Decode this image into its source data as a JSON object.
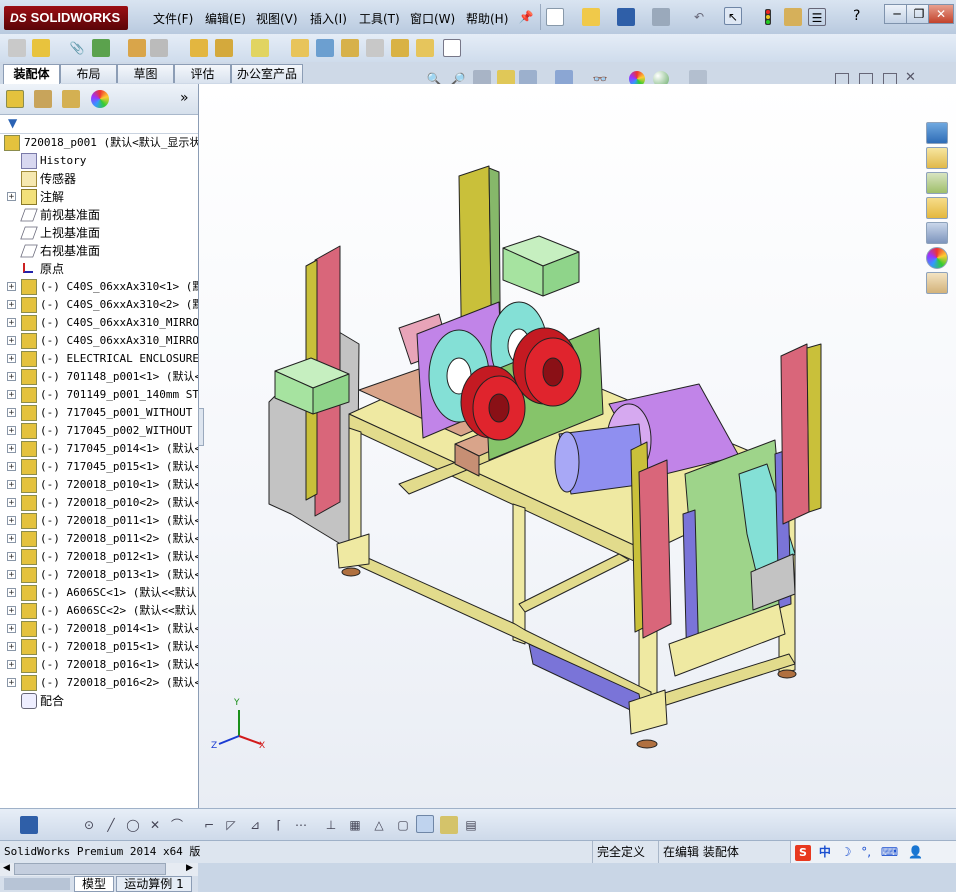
{
  "app": {
    "logo_text": "SOLIDWORKS",
    "logo_prefix": "DS",
    "brand_color": "#8b0c12"
  },
  "menu": [
    {
      "label": "文件(F)"
    },
    {
      "label": "编辑(E)"
    },
    {
      "label": "视图(V)"
    },
    {
      "label": "插入(I)"
    },
    {
      "label": "工具(T)"
    },
    {
      "label": "窗口(W)"
    },
    {
      "label": "帮助(H)"
    }
  ],
  "window_buttons": {
    "minimize": "─",
    "restore": "❐",
    "close": "✕",
    "help": "?"
  },
  "tabs": [
    {
      "label": "装配体",
      "active": true
    },
    {
      "label": "布局",
      "active": false
    },
    {
      "label": "草图",
      "active": false
    },
    {
      "label": "评估",
      "active": false
    },
    {
      "label": "办公室产品",
      "active": false
    }
  ],
  "tree": {
    "root": "720018_p001  (默认<默认_显示状",
    "items": [
      {
        "label": "History",
        "icon": "history-icon",
        "expand": false
      },
      {
        "label": "传感器",
        "icon": "sensor-icon",
        "expand": false
      },
      {
        "label": "注解",
        "icon": "annotation-icon",
        "expand": true
      },
      {
        "label": "前视基准面",
        "icon": "plane-icon",
        "expand": false
      },
      {
        "label": "上视基准面",
        "icon": "plane-icon",
        "expand": false
      },
      {
        "label": "右视基准面",
        "icon": "plane-icon",
        "expand": false
      },
      {
        "label": "原点",
        "icon": "origin-icon",
        "expand": false
      },
      {
        "label": "(-) C40S_06xxAx310<1> (默认",
        "icon": "part-icon",
        "expand": true
      },
      {
        "label": "(-) C40S_06xxAx310<2> (默认",
        "icon": "part-icon",
        "expand": true
      },
      {
        "label": "(-) C40S_06xxAx310_MIRROR<",
        "icon": "part-icon",
        "expand": true
      },
      {
        "label": "(-) C40S_06xxAx310_MIRROR<",
        "icon": "part-icon",
        "expand": true
      },
      {
        "label": "(-) ELECTRICAL ENCLOSURE<",
        "icon": "part-icon",
        "expand": true
      },
      {
        "label": "(-) 701148_p001<1> (默认<",
        "icon": "part-icon",
        "expand": true
      },
      {
        "label": "(-) 701149_p001_140mm STAG",
        "icon": "part-icon",
        "expand": true
      },
      {
        "label": "(-) 717045_p001_WITHOUT OI",
        "icon": "part-icon",
        "expand": true
      },
      {
        "label": "(-) 717045_p002_WITHOUT OI",
        "icon": "part-icon",
        "expand": true
      },
      {
        "label": "(-) 717045_p014<1> (默认<",
        "icon": "part-icon",
        "expand": true
      },
      {
        "label": "(-) 717045_p015<1> (默认<",
        "icon": "part-icon",
        "expand": true
      },
      {
        "label": "(-) 720018_p010<1> (默认<",
        "icon": "part-icon",
        "expand": true
      },
      {
        "label": "(-) 720018_p010<2> (默认<",
        "icon": "part-icon",
        "expand": true
      },
      {
        "label": "(-) 720018_p011<1> (默认<",
        "icon": "part-icon",
        "expand": true
      },
      {
        "label": "(-) 720018_p011<2> (默认<",
        "icon": "part-icon",
        "expand": true
      },
      {
        "label": "(-) 720018_p012<1> (默认<",
        "icon": "part-icon",
        "expand": true
      },
      {
        "label": "(-) 720018_p013<1> (默认<",
        "icon": "part-icon",
        "expand": true
      },
      {
        "label": "(-) A606SC<1> (默认<<默认",
        "icon": "part-icon",
        "expand": true
      },
      {
        "label": "(-) A606SC<2> (默认<<默认",
        "icon": "part-icon",
        "expand": true
      },
      {
        "label": "(-) 720018_p014<1> (默认<",
        "icon": "part-icon",
        "expand": true
      },
      {
        "label": "(-) 720018_p015<1> (默认<",
        "icon": "part-icon",
        "expand": true
      },
      {
        "label": "(-) 720018_p016<1> (默认<",
        "icon": "part-icon",
        "expand": true
      },
      {
        "label": "(-) 720018_p016<2> (默认<",
        "icon": "part-icon",
        "expand": true
      },
      {
        "label": "配合",
        "icon": "mate-icon",
        "expand": false
      }
    ]
  },
  "bottom_tabs": [
    {
      "label": "模型",
      "active": true
    },
    {
      "label": "运动算例 1",
      "active": false
    }
  ],
  "triad": {
    "x": "X",
    "y": "Y",
    "z": "Z"
  },
  "status": {
    "product": "SolidWorks Premium 2014 x64 版",
    "definition": "完全定义",
    "editing": "在编辑 装配体",
    "ime": "中"
  },
  "colors": {
    "frame": "#efe9a2",
    "sensor_pink": "#d9667a",
    "sensor_yellow": "#c9c03a",
    "enclosure_green": "#a6e3a0",
    "coil_red": "#e0242d",
    "coil_violet": "#c184e8",
    "teal": "#84e0d6",
    "blue_purple": "#7a74d8",
    "grey": "#c3c3c3",
    "copper": "#d9a48a"
  }
}
